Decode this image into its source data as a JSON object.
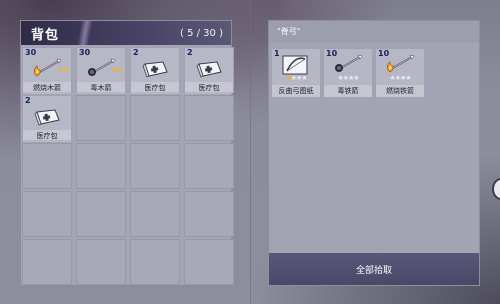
{
  "backpack": {
    "title": "背包",
    "count": "( 5 / 30 )",
    "items": [
      {
        "qty": "30",
        "name": "燃烧木箭",
        "icon": "fire-arrow-icon",
        "stars": "★★",
        "star_color": "#f2b413"
      },
      {
        "qty": "30",
        "name": "毒木箭",
        "icon": "poison-arrow-icon",
        "stars": "★★",
        "star_color": "#f2b413"
      },
      {
        "qty": "2",
        "name": "医疗包",
        "icon": "medkit-icon"
      },
      {
        "qty": "2",
        "name": "医疗包",
        "icon": "medkit-icon"
      },
      {
        "qty": "2",
        "name": "医疗包",
        "icon": "medkit-icon"
      }
    ],
    "total_slots": 20
  },
  "loot": {
    "title": "\"脊弓\"",
    "items": [
      {
        "qty": "1",
        "name": "反曲弓图纸",
        "icon": "recurve-bow-blueprint-icon",
        "stars": "★★★★",
        "gold_stars": 1
      },
      {
        "qty": "10",
        "name": "毒铁箭",
        "icon": "poison-iron-arrow-icon",
        "stars": "★★★★",
        "gold_stars": 0
      },
      {
        "qty": "10",
        "name": "燃烧铁箭",
        "icon": "fire-iron-arrow-icon",
        "stars": "★★★★",
        "gold_stars": 0
      }
    ],
    "pickup_all_label": "全部拾取"
  },
  "colors": {
    "header_dark": "#2f2a45",
    "gold_star": "#f2b413",
    "button": "#4a4868"
  }
}
